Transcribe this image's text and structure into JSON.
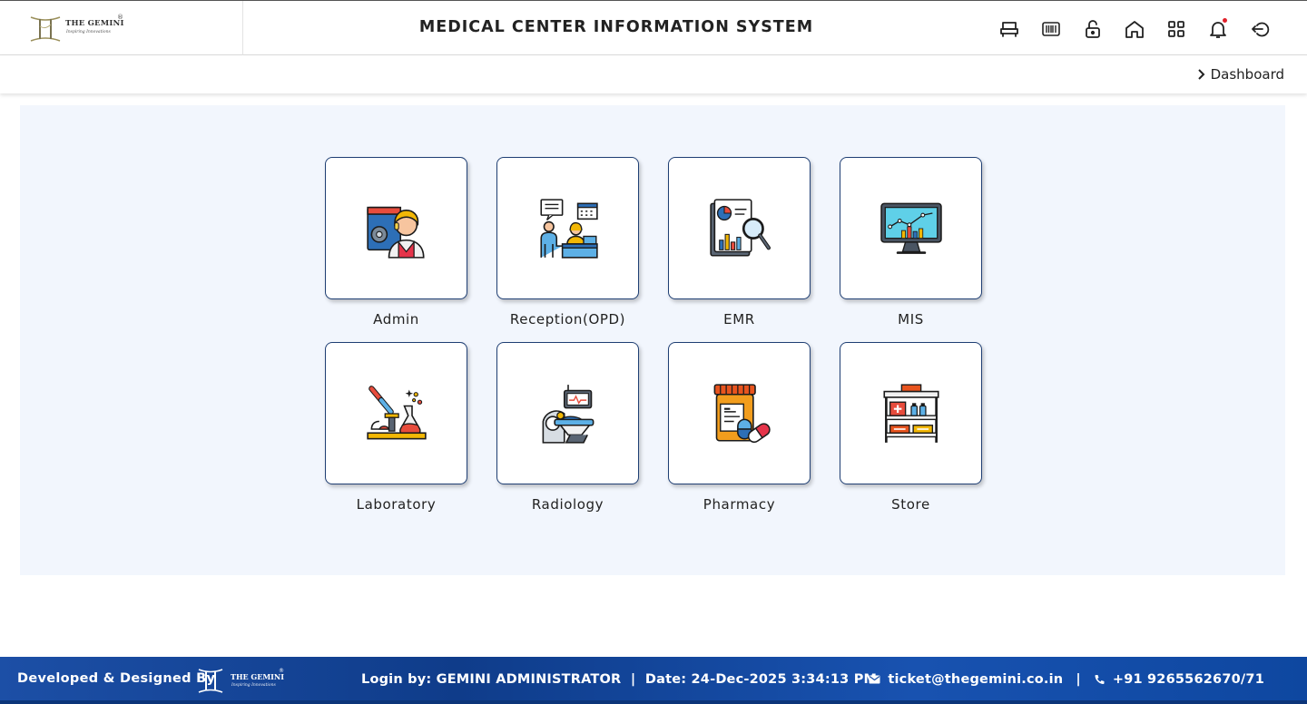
{
  "header": {
    "logo_text": "THE GEMINI",
    "logo_tagline": "Inspiring Innovations",
    "logo_reg": "®",
    "title": "MEDICAL CENTER INFORMATION SYSTEM",
    "icons": [
      "bed-icon",
      "barcode-icon",
      "unlock-icon",
      "home-icon",
      "apps-grid-icon",
      "bell-icon",
      "logout-icon"
    ]
  },
  "breadcrumb": {
    "current": "Dashboard"
  },
  "modules": [
    {
      "label": "Admin",
      "icon": "admin-icon"
    },
    {
      "label": "Reception(OPD)",
      "icon": "reception-icon"
    },
    {
      "label": "EMR",
      "icon": "emr-icon"
    },
    {
      "label": "MIS",
      "icon": "mis-icon"
    },
    {
      "label": "Laboratory",
      "icon": "laboratory-icon"
    },
    {
      "label": "Radiology",
      "icon": "radiology-icon"
    },
    {
      "label": "Pharmacy",
      "icon": "pharmacy-icon"
    },
    {
      "label": "Store",
      "icon": "store-icon"
    }
  ],
  "footer": {
    "developed_by": "Developed & Designed By",
    "logo_text": "THE GEMINI",
    "logo_tagline": "Inspiring Innovations",
    "logo_reg": "®",
    "login": "Login by: GEMINI ADMINISTRATOR  |  Date: 24-Dec-2025 3:34:13 PM",
    "email": "ticket@thegemini.co.in",
    "separator": "|",
    "phone": "+91 9265562670/71"
  },
  "colors": {
    "tile_border": "#1f3f74",
    "panel_bg": "#f2f6fd",
    "footer_blue": "#1c4fa6",
    "notification_dot": "#e0202a"
  }
}
